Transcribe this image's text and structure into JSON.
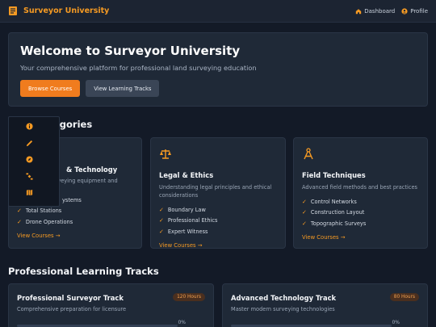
{
  "header": {
    "brand": "Surveyor University",
    "nav": [
      {
        "label": "Dashboard",
        "icon": "home-icon"
      },
      {
        "label": "Profile",
        "icon": "user-icon"
      }
    ]
  },
  "hero": {
    "title": "Welcome to Surveyor University",
    "subtitle": "Your comprehensive platform for professional land surveying education",
    "primary_button": "Browse Courses",
    "secondary_button": "View Learning Tracks"
  },
  "categories": {
    "section_title_visible": "egories",
    "cards": [
      {
        "icon": "tools-icon",
        "title_visible": "& Technology",
        "desc_visible": "surveying equipment and",
        "items_visible": [
          "ystems",
          "Total Stations",
          "Drone Operations"
        ],
        "link": "View Courses →"
      },
      {
        "icon": "scale-icon",
        "title": "Legal & Ethics",
        "desc": "Understanding legal principles and ethical considerations",
        "items": [
          "Boundary Law",
          "Professional Ethics",
          "Expert Witness"
        ],
        "link": "View Courses →"
      },
      {
        "icon": "compass-icon",
        "title": "Field Techniques",
        "desc": "Advanced field methods and best practices",
        "items": [
          "Control Networks",
          "Construction Layout",
          "Topographic Surveys"
        ],
        "link": "View Courses →"
      }
    ]
  },
  "tracks": {
    "section_title": "Professional Learning Tracks",
    "cards": [
      {
        "title": "Professional Surveyor Track",
        "desc": "Comprehensive preparation for licensure",
        "hours": "120 Hours",
        "progress_label": "0%",
        "progress": 0
      },
      {
        "title": "Advanced Technology Track",
        "desc": "Master modern surveying technologies",
        "hours": "80 Hours",
        "progress_label": "0%",
        "progress": 0
      }
    ]
  },
  "side_menu": {
    "items": [
      {
        "icon": "info-icon"
      },
      {
        "icon": "pencil-icon"
      },
      {
        "icon": "compass-icon"
      },
      {
        "icon": "satellite-icon"
      },
      {
        "icon": "map-icon"
      }
    ]
  },
  "colors": {
    "accent": "#f59a23",
    "primary_button": "#f07c1e",
    "background": "#131a27",
    "card": "#1f2937"
  }
}
